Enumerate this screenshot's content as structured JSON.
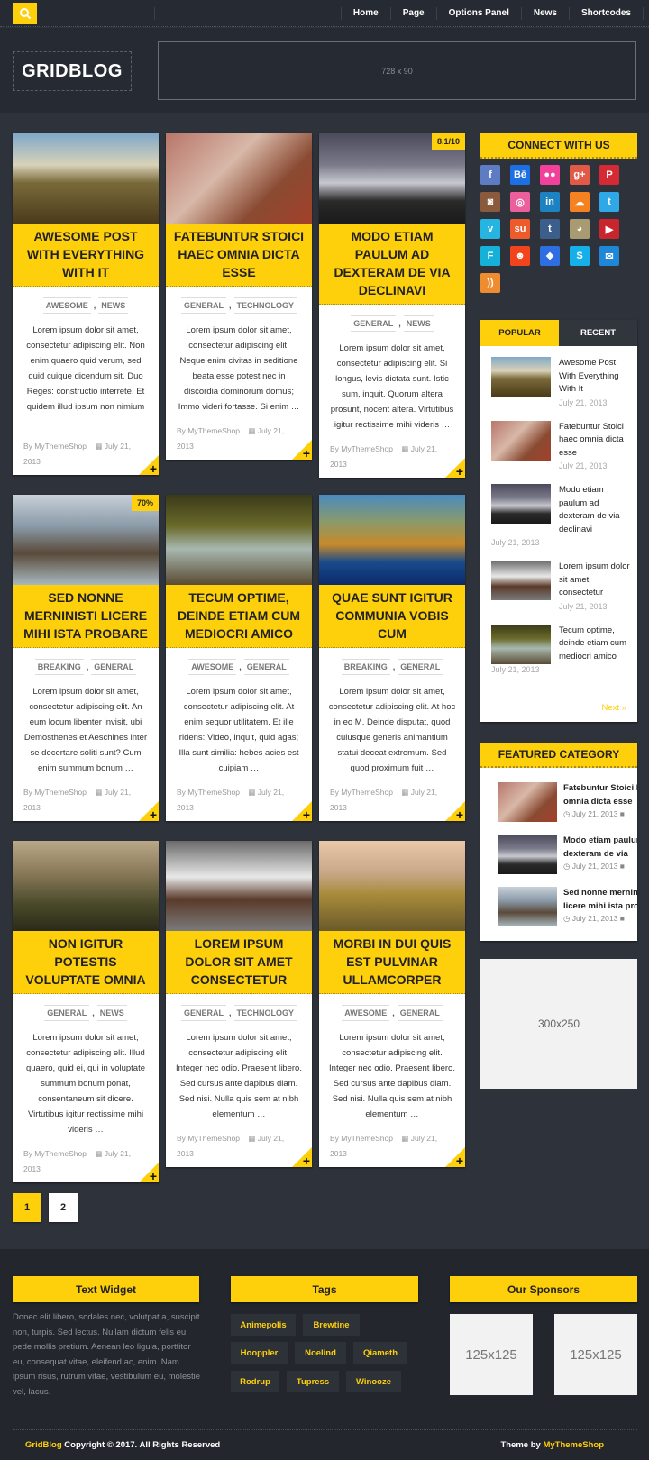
{
  "nav": {
    "search_icon": "search-icon",
    "items": [
      "Home",
      "Page",
      "Options Panel",
      "News",
      "Shortcodes"
    ]
  },
  "header": {
    "logo": "GRIDBLOG",
    "ad_label": "728 x 90"
  },
  "colors": {
    "accent": "#fecf0b",
    "background": "#2e323a",
    "footer": "#23262d"
  },
  "posts": [
    {
      "title": "Awesome Post With Everything With It",
      "badge": "",
      "cats": [
        "AWESOME",
        "NEWS"
      ],
      "excerpt": "Lorem ipsum dolor sit amet, consectetur adipiscing elit. Non enim quaero quid verum, sed quid cuique dicendum sit. Duo Reges: constructio interrete. Et quidem illud ipsum non nimium …",
      "author": "By MyThemeShop",
      "date": "July 21, 2013"
    },
    {
      "title": "Fatebuntur Stoici haec omnia dicta esse",
      "badge": "",
      "cats": [
        "GENERAL",
        "TECHNOLOGY"
      ],
      "excerpt": "Lorem ipsum dolor sit amet, consectetur adipiscing elit. Neque enim civitas in seditione beata esse potest nec in discordia dominorum domus; Immo videri fortasse. Si enim …",
      "author": "By MyThemeShop",
      "date": "July 21, 2013"
    },
    {
      "title": "Modo etiam paulum ad dexteram de via declinavi",
      "badge": "8.1/10",
      "cats": [
        "GENERAL",
        "NEWS"
      ],
      "excerpt": "Lorem ipsum dolor sit amet, consectetur adipiscing elit. Si longus, levis dictata sunt. Istic sum, inquit. Quorum altera prosunt, nocent altera. Virtutibus igitur rectissime mihi videris …",
      "author": "By MyThemeShop",
      "date": "July 21, 2013"
    },
    {
      "title": "Sed nonne merninisti licere mihi ista probare",
      "badge": "70%",
      "cats": [
        "BREAKING",
        "GENERAL"
      ],
      "excerpt": "Lorem ipsum dolor sit amet, consectetur adipiscing elit. An eum locum libenter invisit, ubi Demosthenes et Aeschines inter se decertare soliti sunt? Cum enim summum bonum …",
      "author": "By MyThemeShop",
      "date": "July 21, 2013"
    },
    {
      "title": "Tecum optime, deinde etiam cum mediocri amico",
      "badge": "",
      "cats": [
        "AWESOME",
        "GENERAL"
      ],
      "excerpt": "Lorem ipsum dolor sit amet, consectetur adipiscing elit. At enim sequor utilitatem. Et ille ridens: Video, inquit, quid agas; Illa sunt similia: hebes acies est cuipiam …",
      "author": "By MyThemeShop",
      "date": "July 21, 2013"
    },
    {
      "title": "Quae sunt igitur communia vobis cum",
      "badge": "",
      "cats": [
        "BREAKING",
        "GENERAL"
      ],
      "excerpt": "Lorem ipsum dolor sit amet, consectetur adipiscing elit. At hoc in eo M. Deinde disputat, quod cuiusque generis animantium statui deceat extremum. Sed quod proximum fuit …",
      "author": "By MyThemeShop",
      "date": "July 21, 2013"
    },
    {
      "title": "Non igitur potestis voluptate omnia",
      "badge": "",
      "cats": [
        "GENERAL",
        "NEWS"
      ],
      "excerpt": "Lorem ipsum dolor sit amet, consectetur adipiscing elit. Illud quaero, quid ei, qui in voluptate summum bonum ponat, consentaneum sit dicere. Virtutibus igitur rectissime mihi videris …",
      "author": "By MyThemeShop",
      "date": "July 21, 2013"
    },
    {
      "title": "Lorem ipsum dolor sit amet consectetur",
      "badge": "",
      "cats": [
        "GENERAL",
        "TECHNOLOGY"
      ],
      "excerpt": "Lorem ipsum dolor sit amet, consectetur adipiscing elit. Integer nec odio. Praesent libero. Sed cursus ante dapibus diam. Sed nisi. Nulla quis sem at nibh elementum …",
      "author": "By MyThemeShop",
      "date": "July 21, 2013"
    },
    {
      "title": "Morbi in dui quis est pulvinar ullamcorper",
      "badge": "",
      "cats": [
        "AWESOME",
        "GENERAL"
      ],
      "excerpt": "Lorem ipsum dolor sit amet, consectetur adipiscing elit. Integer nec odio. Praesent libero. Sed cursus ante dapibus diam. Sed nisi. Nulla quis sem at nibh elementum …",
      "author": "By MyThemeShop",
      "date": "July 21, 2013"
    }
  ],
  "sidebar": {
    "connect_title": "CONNECT WITH US",
    "social": [
      {
        "name": "facebook",
        "glyph": "f",
        "color": "#5d7cc4"
      },
      {
        "name": "behance",
        "glyph": "Bē",
        "color": "#1d6fe5"
      },
      {
        "name": "flickr",
        "glyph": "●●",
        "color": "#f1419b"
      },
      {
        "name": "google-plus",
        "glyph": "g+",
        "color": "#e05a47"
      },
      {
        "name": "pinterest",
        "glyph": "P",
        "color": "#d52a34"
      },
      {
        "name": "instagram",
        "glyph": "◙",
        "color": "#8a5a3c"
      },
      {
        "name": "dribbble",
        "glyph": "◎",
        "color": "#ea5f9c"
      },
      {
        "name": "linkedin",
        "glyph": "in",
        "color": "#1d82c2"
      },
      {
        "name": "soundcloud",
        "glyph": "☁",
        "color": "#f58221"
      },
      {
        "name": "twitter",
        "glyph": "t",
        "color": "#2fa8e8"
      },
      {
        "name": "vimeo",
        "glyph": "v",
        "color": "#25b5e0"
      },
      {
        "name": "stumbleupon",
        "glyph": "su",
        "color": "#ee5a2a"
      },
      {
        "name": "tumblr",
        "glyph": "t",
        "color": "#3c5e8a"
      },
      {
        "name": "github",
        "glyph": "◕",
        "color": "#a89a71"
      },
      {
        "name": "youtube",
        "glyph": "▶",
        "color": "#c8252c"
      },
      {
        "name": "foursquare",
        "glyph": "F",
        "color": "#15b1d8"
      },
      {
        "name": "reddit",
        "glyph": "☻",
        "color": "#f1441d"
      },
      {
        "name": "dropbox",
        "glyph": "❖",
        "color": "#2f6ee0"
      },
      {
        "name": "skype",
        "glyph": "S",
        "color": "#16b0e8"
      },
      {
        "name": "email",
        "glyph": "✉",
        "color": "#1f87d8"
      },
      {
        "name": "rss",
        "glyph": "))",
        "color": "#ef8c2f"
      }
    ],
    "tabs": {
      "popular": "POPULAR",
      "recent": "RECENT"
    },
    "popular": [
      {
        "title": "Awesome Post With Everything With It",
        "date": "July 21, 2013"
      },
      {
        "title": "Fatebuntur Stoici haec omnia dicta esse",
        "date": "July 21, 2013"
      },
      {
        "title": "Modo etiam paulum ad dexteram de via declinavi",
        "date": "July 21, 2013"
      },
      {
        "title": "Lorem ipsum dolor sit amet consectetur",
        "date": "July 21, 2013"
      },
      {
        "title": "Tecum optime, deinde etiam cum mediocri amico",
        "date": "July 21, 2013"
      }
    ],
    "next_label": "Next »",
    "featured_title": "FEATURED CATEGORY",
    "featured": [
      {
        "title": "Fatebuntur Stoici haec omnia dicta esse",
        "date": "July 21, 2013"
      },
      {
        "title": "Modo etiam paulum ad dexteram de via",
        "date": "July 21, 2013"
      },
      {
        "title": "Sed nonne merninisti licere mihi ista probare",
        "date": "July 21, 2013"
      }
    ],
    "ad_label": "300x250"
  },
  "pagination": [
    "1",
    "2"
  ],
  "footer": {
    "text_widget_title": "Text Widget",
    "text_widget_body": "Donec elit libero, sodales nec, volutpat a, suscipit non, turpis. Sed lectus. Nullam dictum felis eu pede mollis pretium. Aenean leo ligula, porttitor eu, consequat vitae, eleifend ac, enim. Nam ipsum risus, rutrum vitae, vestibulum eu, molestie vel, lacus.",
    "tags_title": "Tags",
    "tags": [
      "Animepolis",
      "Brewtine",
      "Hooppler",
      "Noelind",
      "Qiameth",
      "Rodrup",
      "Tupress",
      "Winooze"
    ],
    "sponsors_title": "Our Sponsors",
    "sponsors": [
      "125x125",
      "125x125"
    ],
    "copyright_brand": "GridBlog",
    "copyright_text": " Copyright © 2017. All Rights Reserved",
    "theme_by": "Theme by ",
    "theme_link": "MyThemeShop"
  }
}
